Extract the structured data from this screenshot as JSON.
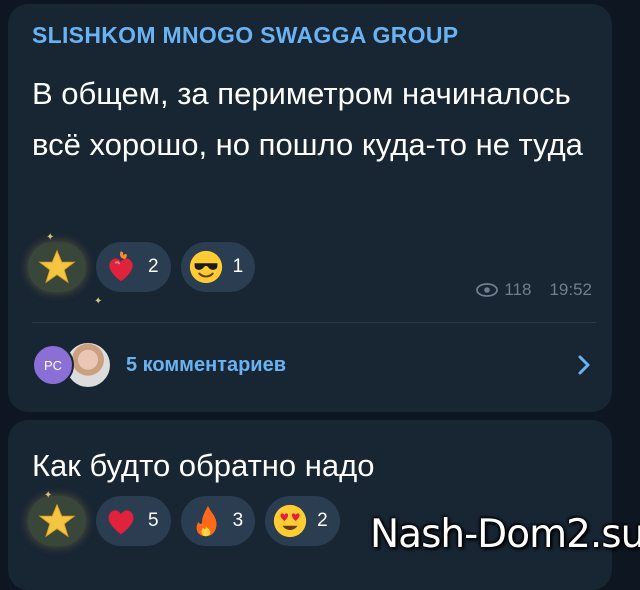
{
  "message1": {
    "channel": "SLISHKOM MNOGO SWAGGA GROUP",
    "text": "В общем, за периметром начиналось всё хорошо, но пошло куда-то не туда",
    "reactions": [
      {
        "icon": "star-icon",
        "count": ""
      },
      {
        "icon": "heart-on-fire-icon",
        "count": "2"
      },
      {
        "icon": "sunglasses-face-icon",
        "count": "1"
      }
    ],
    "views": "118",
    "time": "19:52",
    "comments": {
      "avatar_initials": "PC",
      "label": "5 комментариев"
    }
  },
  "message2": {
    "text": "Как будто обратно надо",
    "reactions": [
      {
        "icon": "star-icon",
        "count": ""
      },
      {
        "icon": "red-heart-icon",
        "count": "5"
      },
      {
        "icon": "fire-icon",
        "count": "3"
      },
      {
        "icon": "heart-eyes-icon",
        "count": "2"
      }
    ]
  },
  "watermark": "Nash-Dom2.su",
  "colors": {
    "background": "#0e1621",
    "bubble": "#182533",
    "accent": "#6ab3f3",
    "reaction_bg": "#2b3d51"
  }
}
